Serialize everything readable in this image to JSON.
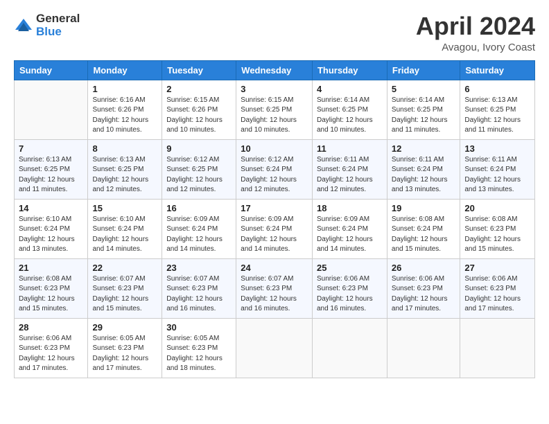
{
  "logo": {
    "general": "General",
    "blue": "Blue"
  },
  "title": "April 2024",
  "location": "Avagou, Ivory Coast",
  "days_of_week": [
    "Sunday",
    "Monday",
    "Tuesday",
    "Wednesday",
    "Thursday",
    "Friday",
    "Saturday"
  ],
  "weeks": [
    [
      {
        "day": "",
        "info": ""
      },
      {
        "day": "1",
        "info": "Sunrise: 6:16 AM\nSunset: 6:26 PM\nDaylight: 12 hours\nand 10 minutes."
      },
      {
        "day": "2",
        "info": "Sunrise: 6:15 AM\nSunset: 6:26 PM\nDaylight: 12 hours\nand 10 minutes."
      },
      {
        "day": "3",
        "info": "Sunrise: 6:15 AM\nSunset: 6:25 PM\nDaylight: 12 hours\nand 10 minutes."
      },
      {
        "day": "4",
        "info": "Sunrise: 6:14 AM\nSunset: 6:25 PM\nDaylight: 12 hours\nand 10 minutes."
      },
      {
        "day": "5",
        "info": "Sunrise: 6:14 AM\nSunset: 6:25 PM\nDaylight: 12 hours\nand 11 minutes."
      },
      {
        "day": "6",
        "info": "Sunrise: 6:13 AM\nSunset: 6:25 PM\nDaylight: 12 hours\nand 11 minutes."
      }
    ],
    [
      {
        "day": "7",
        "info": "Sunrise: 6:13 AM\nSunset: 6:25 PM\nDaylight: 12 hours\nand 11 minutes."
      },
      {
        "day": "8",
        "info": "Sunrise: 6:13 AM\nSunset: 6:25 PM\nDaylight: 12 hours\nand 12 minutes."
      },
      {
        "day": "9",
        "info": "Sunrise: 6:12 AM\nSunset: 6:25 PM\nDaylight: 12 hours\nand 12 minutes."
      },
      {
        "day": "10",
        "info": "Sunrise: 6:12 AM\nSunset: 6:24 PM\nDaylight: 12 hours\nand 12 minutes."
      },
      {
        "day": "11",
        "info": "Sunrise: 6:11 AM\nSunset: 6:24 PM\nDaylight: 12 hours\nand 12 minutes."
      },
      {
        "day": "12",
        "info": "Sunrise: 6:11 AM\nSunset: 6:24 PM\nDaylight: 12 hours\nand 13 minutes."
      },
      {
        "day": "13",
        "info": "Sunrise: 6:11 AM\nSunset: 6:24 PM\nDaylight: 12 hours\nand 13 minutes."
      }
    ],
    [
      {
        "day": "14",
        "info": "Sunrise: 6:10 AM\nSunset: 6:24 PM\nDaylight: 12 hours\nand 13 minutes."
      },
      {
        "day": "15",
        "info": "Sunrise: 6:10 AM\nSunset: 6:24 PM\nDaylight: 12 hours\nand 14 minutes."
      },
      {
        "day": "16",
        "info": "Sunrise: 6:09 AM\nSunset: 6:24 PM\nDaylight: 12 hours\nand 14 minutes."
      },
      {
        "day": "17",
        "info": "Sunrise: 6:09 AM\nSunset: 6:24 PM\nDaylight: 12 hours\nand 14 minutes."
      },
      {
        "day": "18",
        "info": "Sunrise: 6:09 AM\nSunset: 6:24 PM\nDaylight: 12 hours\nand 14 minutes."
      },
      {
        "day": "19",
        "info": "Sunrise: 6:08 AM\nSunset: 6:24 PM\nDaylight: 12 hours\nand 15 minutes."
      },
      {
        "day": "20",
        "info": "Sunrise: 6:08 AM\nSunset: 6:23 PM\nDaylight: 12 hours\nand 15 minutes."
      }
    ],
    [
      {
        "day": "21",
        "info": "Sunrise: 6:08 AM\nSunset: 6:23 PM\nDaylight: 12 hours\nand 15 minutes."
      },
      {
        "day": "22",
        "info": "Sunrise: 6:07 AM\nSunset: 6:23 PM\nDaylight: 12 hours\nand 15 minutes."
      },
      {
        "day": "23",
        "info": "Sunrise: 6:07 AM\nSunset: 6:23 PM\nDaylight: 12 hours\nand 16 minutes."
      },
      {
        "day": "24",
        "info": "Sunrise: 6:07 AM\nSunset: 6:23 PM\nDaylight: 12 hours\nand 16 minutes."
      },
      {
        "day": "25",
        "info": "Sunrise: 6:06 AM\nSunset: 6:23 PM\nDaylight: 12 hours\nand 16 minutes."
      },
      {
        "day": "26",
        "info": "Sunrise: 6:06 AM\nSunset: 6:23 PM\nDaylight: 12 hours\nand 17 minutes."
      },
      {
        "day": "27",
        "info": "Sunrise: 6:06 AM\nSunset: 6:23 PM\nDaylight: 12 hours\nand 17 minutes."
      }
    ],
    [
      {
        "day": "28",
        "info": "Sunrise: 6:06 AM\nSunset: 6:23 PM\nDaylight: 12 hours\nand 17 minutes."
      },
      {
        "day": "29",
        "info": "Sunrise: 6:05 AM\nSunset: 6:23 PM\nDaylight: 12 hours\nand 17 minutes."
      },
      {
        "day": "30",
        "info": "Sunrise: 6:05 AM\nSunset: 6:23 PM\nDaylight: 12 hours\nand 18 minutes."
      },
      {
        "day": "",
        "info": ""
      },
      {
        "day": "",
        "info": ""
      },
      {
        "day": "",
        "info": ""
      },
      {
        "day": "",
        "info": ""
      }
    ]
  ]
}
